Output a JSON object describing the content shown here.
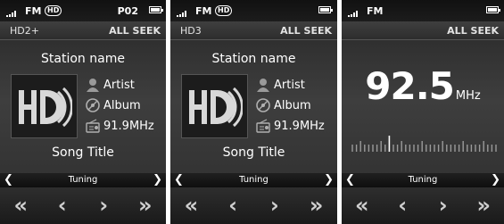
{
  "screens": [
    {
      "status": {
        "band": "FM",
        "hd_indicator": "HD",
        "preset": "P02"
      },
      "info": {
        "channel": "HD2+",
        "seek_mode": "ALL SEEK"
      },
      "station_name": "Station name",
      "artist": "Artist",
      "album": "Album",
      "frequency": "91.9MHz",
      "song_title": "Song Title",
      "tuning_label": "Tuning"
    },
    {
      "status": {
        "band": "FM",
        "hd_indicator": "HD"
      },
      "info": {
        "channel": "HD3",
        "seek_mode": "ALL SEEK"
      },
      "station_name": "Station name",
      "artist": "Artist",
      "album": "Album",
      "frequency": "91.9MHz",
      "song_title": "Song Title",
      "tuning_label": "Tuning"
    },
    {
      "status": {
        "band": "FM"
      },
      "info": {
        "seek_mode": "ALL SEEK"
      },
      "frequency_value": "92.5",
      "frequency_unit": "MHz",
      "tuning_label": "Tuning"
    }
  ],
  "controls": {
    "seek_back": "«",
    "tune_down": "‹",
    "tune_up": "›",
    "seek_forward": "»"
  },
  "tuning_arrows": {
    "left": "❮",
    "right": "❯"
  },
  "icons": [
    "signal-icon",
    "battery-icon",
    "hd-logo-icon",
    "artist-icon",
    "album-icon",
    "radio-icon",
    "seek-back-icon",
    "tune-down-icon",
    "tune-up-icon",
    "seek-forward-icon"
  ],
  "colors": {
    "screen_bg": "#3a3a3a",
    "text": "#ffffff",
    "dim_text": "#cfcfcf"
  }
}
